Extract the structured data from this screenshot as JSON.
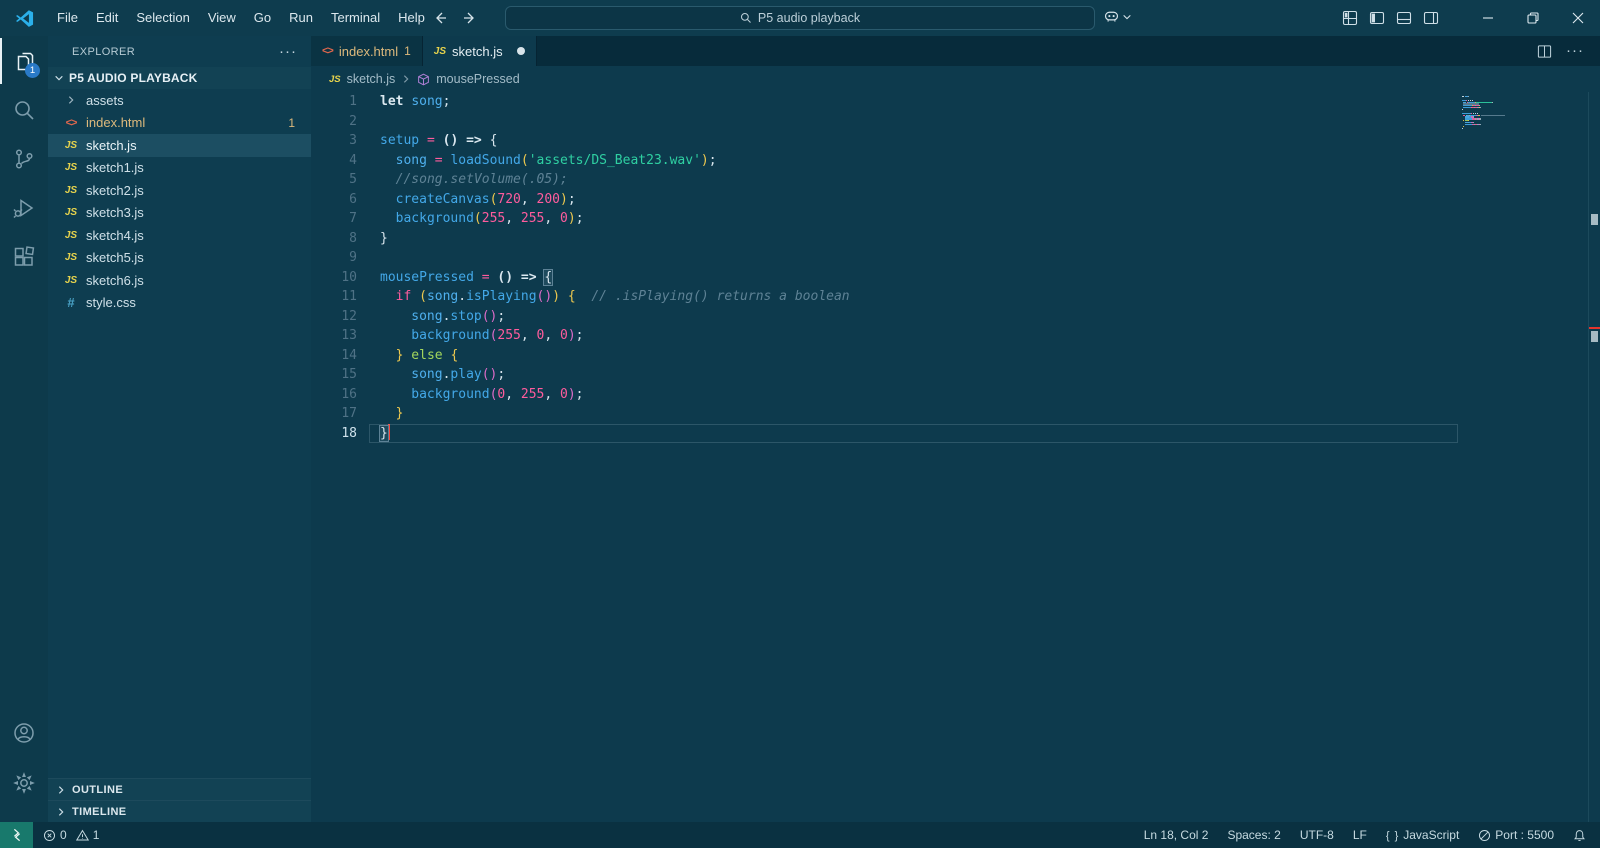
{
  "titlebar": {
    "menus": [
      "File",
      "Edit",
      "Selection",
      "View",
      "Go",
      "Run",
      "Terminal",
      "Help"
    ],
    "command_center": "P5 audio playback"
  },
  "activity_bar": {
    "items": [
      {
        "id": "explorer",
        "badge": "1",
        "active": true
      },
      {
        "id": "search"
      },
      {
        "id": "source-control"
      },
      {
        "id": "run-debug"
      },
      {
        "id": "extensions"
      }
    ],
    "bottom_items": [
      {
        "id": "accounts"
      },
      {
        "id": "settings"
      }
    ]
  },
  "sidebar": {
    "title": "EXPLORER",
    "project": "P5 AUDIO PLAYBACK",
    "files": [
      {
        "name": "assets",
        "type": "folder"
      },
      {
        "name": "index.html",
        "type": "html",
        "badge": "1",
        "modified": true
      },
      {
        "name": "sketch.js",
        "type": "js",
        "selected": true
      },
      {
        "name": "sketch1.js",
        "type": "js"
      },
      {
        "name": "sketch2.js",
        "type": "js"
      },
      {
        "name": "sketch3.js",
        "type": "js"
      },
      {
        "name": "sketch4.js",
        "type": "js"
      },
      {
        "name": "sketch5.js",
        "type": "js"
      },
      {
        "name": "sketch6.js",
        "type": "js"
      },
      {
        "name": "style.css",
        "type": "css"
      }
    ],
    "sections": [
      "OUTLINE",
      "TIMELINE"
    ]
  },
  "tabs": [
    {
      "name": "index.html",
      "icon": "html",
      "badge": "1",
      "modified": true
    },
    {
      "name": "sketch.js",
      "icon": "js",
      "active": true,
      "dirty": true
    }
  ],
  "breadcrumb": {
    "file": "sketch.js",
    "symbol": "mousePressed"
  },
  "editor": {
    "lines": [
      {
        "n": 1,
        "indent": 0,
        "tokens": [
          [
            "kw",
            "let"
          ],
          [
            "pl",
            " "
          ],
          [
            "vr",
            "song"
          ],
          [
            "pl",
            ";"
          ]
        ]
      },
      {
        "n": 2,
        "indent": 0,
        "tokens": []
      },
      {
        "n": 3,
        "indent": 0,
        "tokens": [
          [
            "fn",
            "setup"
          ],
          [
            "pl",
            " "
          ],
          [
            "op",
            "="
          ],
          [
            "pl",
            " "
          ],
          [
            "b1b",
            "()"
          ],
          [
            "pl",
            " "
          ],
          [
            "ar",
            "=>"
          ],
          [
            "pl",
            " "
          ],
          [
            "b1",
            "{"
          ]
        ]
      },
      {
        "n": 4,
        "indent": 1,
        "tokens": [
          [
            "vr",
            "song"
          ],
          [
            "pl",
            " "
          ],
          [
            "op",
            "="
          ],
          [
            "pl",
            " "
          ],
          [
            "fn",
            "loadSound"
          ],
          [
            "b2",
            "("
          ],
          [
            "st",
            "'assets/DS_Beat23.wav'"
          ],
          [
            "b2",
            ")"
          ],
          [
            "pl",
            ";"
          ]
        ]
      },
      {
        "n": 5,
        "indent": 1,
        "tokens": [
          [
            "cm",
            "//song.setVolume(.05);"
          ]
        ]
      },
      {
        "n": 6,
        "indent": 1,
        "tokens": [
          [
            "fn",
            "createCanvas"
          ],
          [
            "b2",
            "("
          ],
          [
            "nm",
            "720"
          ],
          [
            "pl",
            ", "
          ],
          [
            "nm",
            "200"
          ],
          [
            "b2",
            ")"
          ],
          [
            "pl",
            ";"
          ]
        ]
      },
      {
        "n": 7,
        "indent": 1,
        "tokens": [
          [
            "fn",
            "background"
          ],
          [
            "b2",
            "("
          ],
          [
            "nm",
            "255"
          ],
          [
            "pl",
            ", "
          ],
          [
            "nm",
            "255"
          ],
          [
            "pl",
            ", "
          ],
          [
            "nm",
            "0"
          ],
          [
            "b2",
            ")"
          ],
          [
            "pl",
            ";"
          ]
        ]
      },
      {
        "n": 8,
        "indent": 0,
        "tokens": [
          [
            "b1",
            "}"
          ]
        ]
      },
      {
        "n": 9,
        "indent": 0,
        "tokens": []
      },
      {
        "n": 10,
        "indent": 0,
        "tokens": [
          [
            "fn",
            "mousePressed"
          ],
          [
            "pl",
            " "
          ],
          [
            "op",
            "="
          ],
          [
            "pl",
            " "
          ],
          [
            "b1b",
            "()"
          ],
          [
            "pl",
            " "
          ],
          [
            "ar",
            "=>"
          ],
          [
            "pl",
            " "
          ],
          [
            "b1",
            "{",
            "bm"
          ]
        ]
      },
      {
        "n": 11,
        "indent": 1,
        "tokens": [
          [
            "kwp",
            "if"
          ],
          [
            "pl",
            " "
          ],
          [
            "b2",
            "("
          ],
          [
            "vr",
            "song"
          ],
          [
            "pl",
            "."
          ],
          [
            "fn",
            "isPlaying"
          ],
          [
            "b3",
            "()"
          ],
          [
            "b2",
            ")"
          ],
          [
            "pl",
            " "
          ],
          [
            "b2",
            "{"
          ],
          [
            "pl",
            "  "
          ],
          [
            "cm",
            "// .isPlaying() returns a boolean"
          ]
        ]
      },
      {
        "n": 12,
        "indent": 2,
        "tokens": [
          [
            "vr",
            "song"
          ],
          [
            "pl",
            "."
          ],
          [
            "fn",
            "stop"
          ],
          [
            "b3",
            "()"
          ],
          [
            "pl",
            ";"
          ]
        ]
      },
      {
        "n": 13,
        "indent": 2,
        "tokens": [
          [
            "fn",
            "background"
          ],
          [
            "b3",
            "("
          ],
          [
            "nm",
            "255"
          ],
          [
            "pl",
            ", "
          ],
          [
            "nm",
            "0"
          ],
          [
            "pl",
            ", "
          ],
          [
            "nm",
            "0"
          ],
          [
            "b3",
            ")"
          ],
          [
            "pl",
            ";"
          ]
        ]
      },
      {
        "n": 14,
        "indent": 1,
        "tokens": [
          [
            "b2",
            "}"
          ],
          [
            "pl",
            " "
          ],
          [
            "kwg",
            "else"
          ],
          [
            "pl",
            " "
          ],
          [
            "b2",
            "{"
          ]
        ]
      },
      {
        "n": 15,
        "indent": 2,
        "tokens": [
          [
            "vr",
            "song"
          ],
          [
            "pl",
            "."
          ],
          [
            "fn",
            "play"
          ],
          [
            "b3",
            "()"
          ],
          [
            "pl",
            ";"
          ]
        ]
      },
      {
        "n": 16,
        "indent": 2,
        "tokens": [
          [
            "fn",
            "background"
          ],
          [
            "b3",
            "("
          ],
          [
            "nm",
            "0"
          ],
          [
            "pl",
            ", "
          ],
          [
            "nm",
            "255"
          ],
          [
            "pl",
            ", "
          ],
          [
            "nm",
            "0"
          ],
          [
            "b3",
            ")"
          ],
          [
            "pl",
            ";"
          ]
        ]
      },
      {
        "n": 17,
        "indent": 1,
        "tokens": [
          [
            "b2",
            "}"
          ]
        ]
      },
      {
        "n": 18,
        "indent": 0,
        "current": true,
        "cursor": true,
        "tokens": [
          [
            "b1",
            "}",
            "bm"
          ]
        ]
      }
    ]
  },
  "statusbar": {
    "problems": {
      "errors": "0",
      "warnings": "1"
    },
    "right_items": [
      {
        "label": "Ln 18, Col 2"
      },
      {
        "label": "Spaces: 2"
      },
      {
        "label": "UTF-8"
      },
      {
        "label": "LF"
      },
      {
        "icon": "braces",
        "label": "JavaScript"
      },
      {
        "icon": "circle-slash",
        "label": "Port : 5500"
      },
      {
        "icon": "bell",
        "label": ""
      }
    ]
  },
  "colors": {
    "editor_background": "#0d3a4d",
    "sidebar_background": "#0e3d50",
    "statusbar_background": "#0a3141",
    "remote_indicator": "#18796c",
    "badge_blue": "#2a7ac7",
    "cursor_red": "#ff4136",
    "modified_yellow": "#ddb97c",
    "string_green": "#2fd0a2",
    "number_pink": "#ff5c9d",
    "function_blue": "#43a8e8",
    "bracket_gold": "#eec94f",
    "bracket_orchid": "#dd6cc8"
  }
}
